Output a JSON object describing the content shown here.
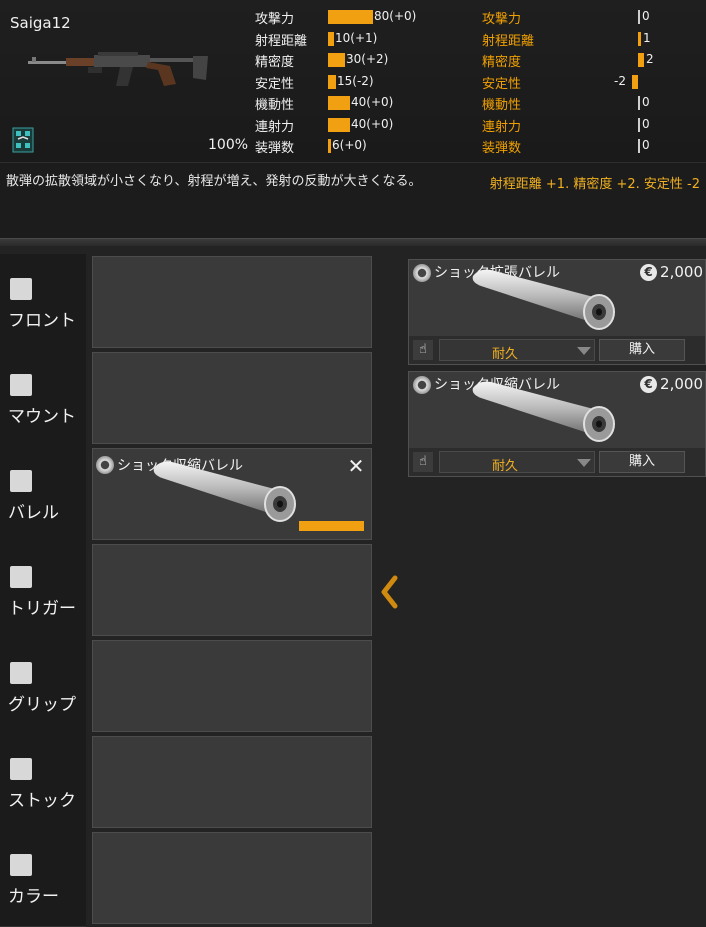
{
  "weapon": {
    "name": "Saiga12",
    "durability_percent": "100%",
    "stats": [
      {
        "label": "攻撃力",
        "value": "80(+0)",
        "level": 80
      },
      {
        "label": "射程距離",
        "value": "10(+1)",
        "level": 10
      },
      {
        "label": "精密度",
        "value": "30(+2)",
        "level": 30
      },
      {
        "label": "安定性",
        "value": "15(-2)",
        "level": 15
      },
      {
        "label": "機動性",
        "value": "40(+0)",
        "level": 40
      },
      {
        "label": "連射力",
        "value": "40(+0)",
        "level": 40
      },
      {
        "label": "装弾数",
        "value": "6(+0)",
        "level": 6
      }
    ]
  },
  "compare": {
    "stats": [
      {
        "label": "攻撃力",
        "value": "0"
      },
      {
        "label": "射程距離",
        "value": "1"
      },
      {
        "label": "精密度",
        "value": "2"
      },
      {
        "label": "安定性",
        "value": "-2"
      },
      {
        "label": "機動性",
        "value": "0"
      },
      {
        "label": "連射力",
        "value": "0"
      },
      {
        "label": "装弾数",
        "value": "0"
      }
    ]
  },
  "description": {
    "text": "散弾の拡散領域が小さくなり、射程が増え、発射の反動が大きくなる。",
    "effect": "射程距離 +1. 精密度 +2. 安定性 -2"
  },
  "slots": [
    {
      "name": "フロント",
      "icon": "front-sight-icon"
    },
    {
      "name": "マウント",
      "icon": "scope-mount-icon"
    },
    {
      "name": "バレル",
      "icon": "barrel-icon"
    },
    {
      "name": "トリガー",
      "icon": "trigger-icon"
    },
    {
      "name": "グリップ",
      "icon": "grip-icon"
    },
    {
      "name": "ストック",
      "icon": "stock-icon"
    },
    {
      "name": "カラー",
      "icon": "paint-icon"
    }
  ],
  "equipped": {
    "slot": "バレル",
    "title": "ショック収縮バレル",
    "durability_level": 1.0
  },
  "shop": {
    "items": [
      {
        "title": "ショック拡張バレル",
        "price": "2,000",
        "durability": "耐久",
        "buy_label": "購入"
      },
      {
        "title": "ショック収縮バレル",
        "price": "2,000",
        "durability": "耐久",
        "buy_label": "購入"
      }
    ],
    "coin_symbol": "€"
  },
  "colors": {
    "accent": "#f0a010",
    "effect_text": "#f0b020"
  }
}
